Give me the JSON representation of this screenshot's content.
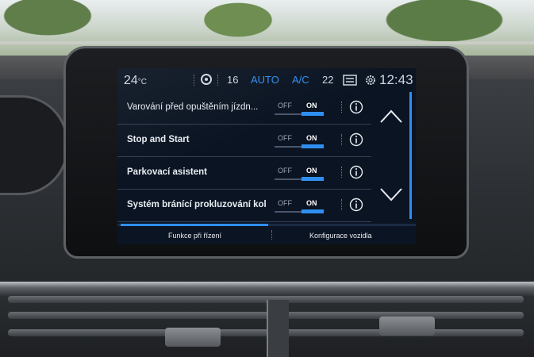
{
  "status": {
    "left_temp": "24",
    "left_temp_unit": "°C",
    "fan_speed": "16",
    "auto_label": "AUTO",
    "ac_label": "A/C",
    "right_temp": "22",
    "time": "12:43",
    "icons": [
      "fan-icon",
      "recirculation-icon",
      "gear-icon"
    ]
  },
  "settings": [
    {
      "label": "Varování před opuštěním jízdn...",
      "off": "OFF",
      "on": "ON",
      "state": "on"
    },
    {
      "label": "Stop and Start",
      "off": "OFF",
      "on": "ON",
      "state": "on"
    },
    {
      "label": "Parkovací asistent",
      "off": "OFF",
      "on": "ON",
      "state": "on"
    },
    {
      "label": "Systém bránící prokluzování kol",
      "off": "OFF",
      "on": "ON",
      "state": "on"
    }
  ],
  "tabs": [
    {
      "label": "Funkce při řízení",
      "active": true
    },
    {
      "label": "Konfigurace vozidla",
      "active": false
    }
  ],
  "colors": {
    "accent": "#2f8ff0",
    "screen_bg": "#0b1422",
    "text": "#e9edf3"
  }
}
